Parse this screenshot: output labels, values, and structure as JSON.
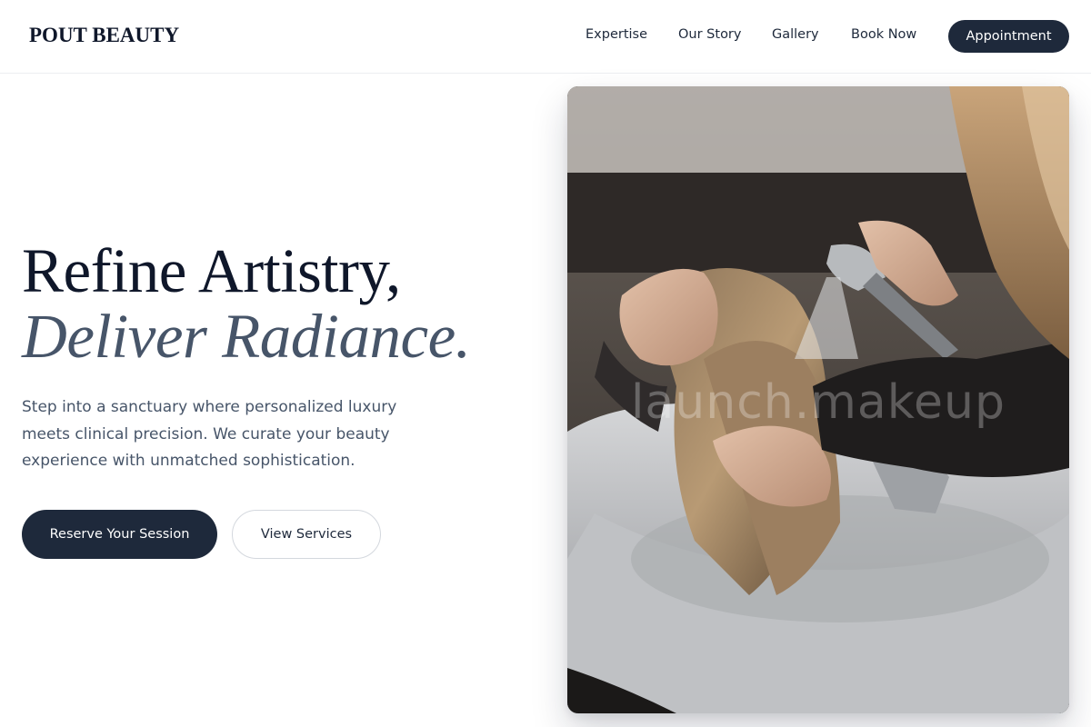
{
  "brand": {
    "logo": "POUT BEAUTY"
  },
  "nav": {
    "items": [
      {
        "label": "Expertise"
      },
      {
        "label": "Our Story"
      },
      {
        "label": "Gallery"
      },
      {
        "label": "Book Now"
      }
    ],
    "cta_label": "Appointment"
  },
  "hero": {
    "title_line1": "Refine Artistry,",
    "title_line2": "Deliver Radiance.",
    "description": "Step into a sanctuary where personalized luxury meets clinical precision. We curate your beauty experience with unmatched sophistication.",
    "primary_button": "Reserve Your Session",
    "secondary_button": "View Services",
    "image_watermark": "launch.makeup"
  },
  "colors": {
    "primary": "#1e293b",
    "heading": "#0f172a",
    "accent_text": "#475569",
    "border": "#d4d8de"
  }
}
